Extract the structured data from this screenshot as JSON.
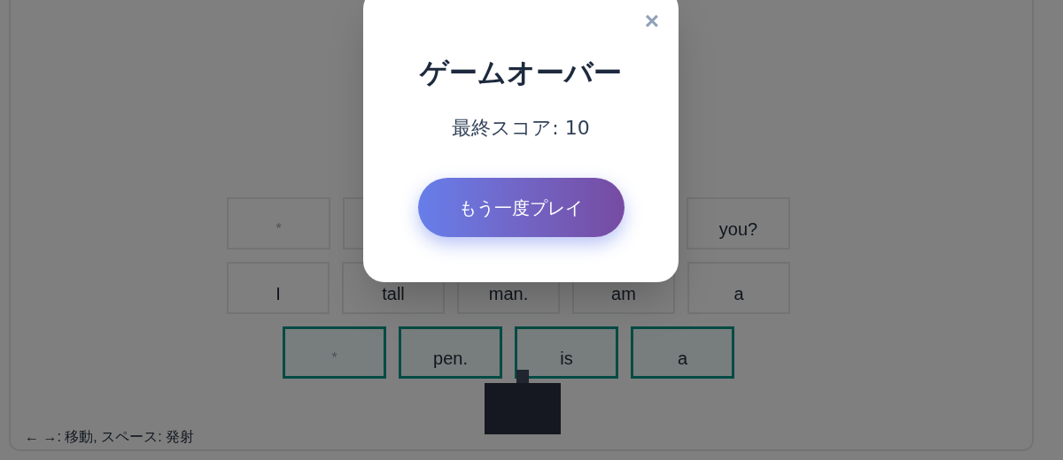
{
  "board": {
    "rows": [
      {
        "active": false,
        "tiles": [
          {
            "kind": "wildcard",
            "text": "*"
          },
          {
            "kind": "word"
          },
          {
            "kind": "word",
            "text": "you?"
          }
        ]
      },
      {
        "active": false,
        "tiles": [
          {
            "kind": "word",
            "text": "I"
          },
          {
            "kind": "word",
            "text": "tall"
          },
          {
            "kind": "word",
            "text": "man."
          },
          {
            "kind": "word",
            "text": "am"
          },
          {
            "kind": "word",
            "text": "a"
          }
        ]
      },
      {
        "active": true,
        "tiles": [
          {
            "kind": "wildcard",
            "text": "*"
          },
          {
            "kind": "word",
            "text": "pen."
          },
          {
            "kind": "word",
            "text": "is"
          },
          {
            "kind": "word",
            "text": "a"
          }
        ]
      }
    ],
    "hint": "← →: 移動, スペース: 発射"
  },
  "dialog": {
    "close": "×",
    "title": "ゲームオーバー",
    "score": "最終スコア: 10",
    "button": "もう一度プレイ"
  }
}
